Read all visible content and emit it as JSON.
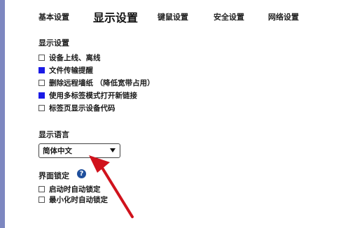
{
  "tabs": [
    {
      "label": "基本设置"
    },
    {
      "label": "显示设置",
      "active": true
    },
    {
      "label": "键鼠设置"
    },
    {
      "label": "安全设置"
    },
    {
      "label": "网络设置"
    }
  ],
  "display": {
    "title": "显示设置",
    "options": [
      {
        "label": "设备上线、离线",
        "checked": false
      },
      {
        "label": "文件传输提醒",
        "checked": true
      },
      {
        "label": "删除远程墙纸 （降低宽带占用）",
        "checked": false
      },
      {
        "label": "使用多标签模式打开新链接",
        "checked": true
      },
      {
        "label": "标签页显示设备代码",
        "checked": false
      }
    ]
  },
  "language": {
    "title": "显示语言",
    "selected": "简体中文"
  },
  "lock": {
    "title": "界面锁定",
    "help_glyph": "?",
    "options": [
      {
        "label": "启动时自动锁定",
        "checked": false
      },
      {
        "label": "最小化时自动锁定",
        "checked": false
      }
    ]
  },
  "colors": {
    "accent": "#1a1ae6",
    "sidebar": "#7d87c0",
    "arrow": "#d0121c",
    "help": "#1f4f9c"
  }
}
